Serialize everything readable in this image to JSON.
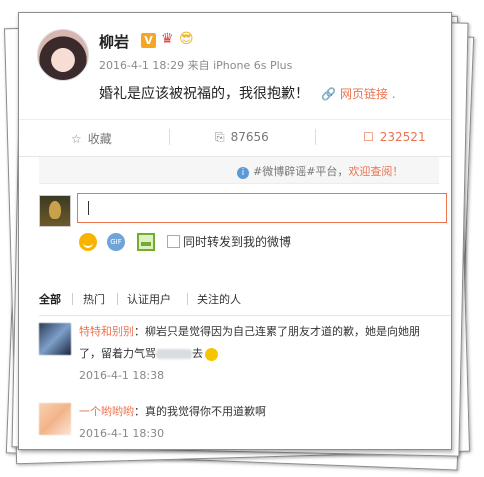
{
  "post": {
    "username": "柳岩",
    "badge": "V",
    "meta": "2016-4-1 18:29 来自 iPhone 6s Plus",
    "text": "婚礼是应该被祝福的，我很抱歉！",
    "link_label": "网页链接",
    "link_suffix": "."
  },
  "actions": {
    "favorite": "收藏",
    "repost": "87656",
    "comment": "232521"
  },
  "notice": {
    "text": "#微博辟谣#平台，",
    "highlight": "欢迎查阅！"
  },
  "composer": {
    "repost_option": "同时转发到我的微博",
    "gif_label": "GIF"
  },
  "tabs": [
    "全部",
    "热门",
    "认证用户",
    "关注的人"
  ],
  "comments": [
    {
      "name": "特特和别别",
      "text_a": "：柳岩只是觉得因为自己连累了朋友才道的歉，她是向她朋",
      "text_b": "了，留着力气骂",
      "text_c": "去",
      "time": "2016-4-1 18:38"
    },
    {
      "name": "一个哟哟哟",
      "text": "：真的我觉得你不用道歉啊",
      "time": "2016-4-1 18:30"
    }
  ],
  "icons": {
    "favorite": "star-icon",
    "repost": "repost-icon",
    "comment": "comment-icon",
    "link": "link-icon",
    "info": "info-icon"
  },
  "colors": {
    "accent": "#eb7350",
    "badge": "#f5a623"
  }
}
